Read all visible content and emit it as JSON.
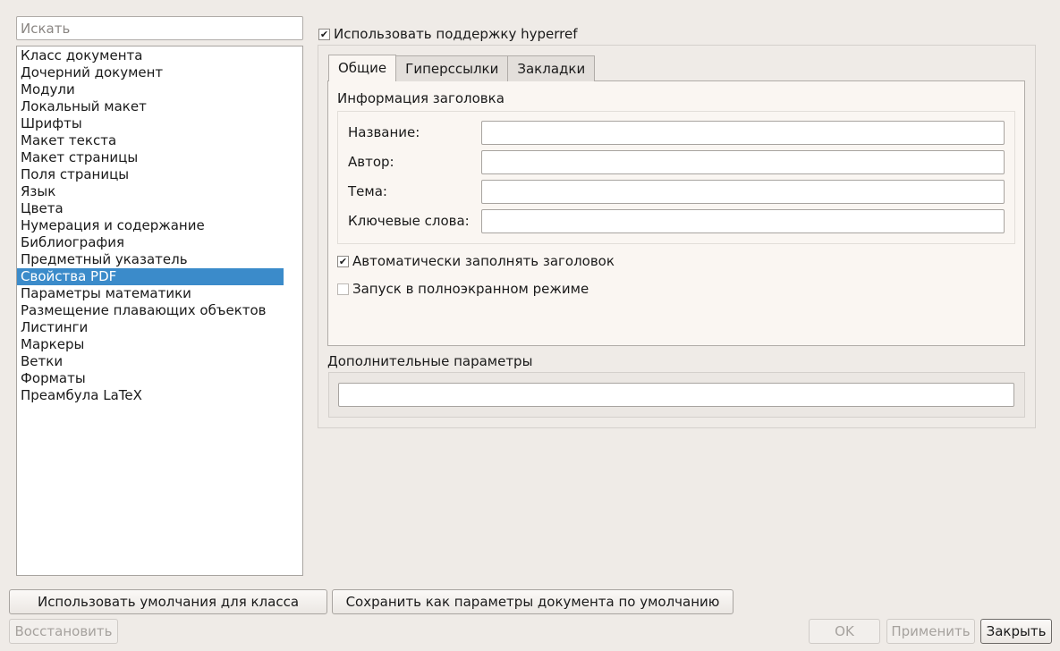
{
  "search": {
    "placeholder": "Искать"
  },
  "nav": {
    "items": [
      "Класс документа",
      "Дочерний документ",
      "Модули",
      "Локальный макет",
      "Шрифты",
      "Макет текста",
      "Макет страницы",
      "Поля страницы",
      "Язык",
      "Цвета",
      "Нумерация и содержание",
      "Библиография",
      "Предметный указатель",
      "Свойства PDF",
      "Параметры математики",
      "Размещение плавающих объектов",
      "Листинги",
      "Маркеры",
      "Ветки",
      "Форматы",
      "Преамбула LaTeX"
    ],
    "selected": "Свойства PDF"
  },
  "hyperref": {
    "label": "Использовать поддержку hyperref",
    "checked": true
  },
  "tabs": [
    {
      "label": "Общие",
      "active": true
    },
    {
      "label": "Гиперссылки",
      "active": false
    },
    {
      "label": "Закладки",
      "active": false
    }
  ],
  "header_info": {
    "title": "Информация заголовка",
    "fields": [
      {
        "label": "Название:",
        "value": ""
      },
      {
        "label": "Автор:",
        "value": ""
      },
      {
        "label": "Тема:",
        "value": ""
      },
      {
        "label": "Ключевые слова:",
        "value": ""
      }
    ]
  },
  "options": {
    "auto_fill": {
      "label": "Автоматически заполнять заголовок",
      "checked": true
    },
    "fullscreen": {
      "label": "Запуск в полноэкранном режиме",
      "checked": false
    }
  },
  "extra": {
    "title": "Дополнительные параметры",
    "value": ""
  },
  "buttons": {
    "use_class_defaults": "Использовать умолчания для класса",
    "save_as_defaults": "Сохранить как параметры документа по умолчанию",
    "restore": "Восстановить",
    "ok": "OK",
    "apply": "Применить",
    "close": "Закрыть"
  },
  "colors": {
    "selection": "#3b8bca",
    "window_bg": "#efebe7"
  }
}
